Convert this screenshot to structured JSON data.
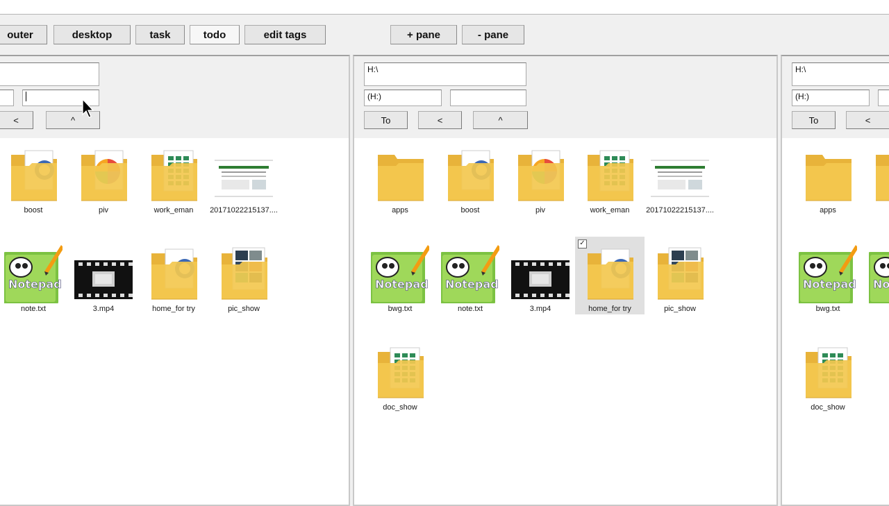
{
  "toolbar": {
    "buttons": [
      {
        "label": "outer"
      },
      {
        "label": "desktop"
      },
      {
        "label": "task"
      },
      {
        "label": "todo"
      },
      {
        "label": "edit tags"
      },
      {
        "label": "+ pane"
      },
      {
        "label": "- pane"
      }
    ]
  },
  "panes": [
    {
      "path": "",
      "drive": "",
      "filter": "",
      "nav": {
        "back": "<",
        "up": "^"
      },
      "items": [
        {
          "label": "boost",
          "icon": "folder-doc-icon"
        },
        {
          "label": "piv",
          "icon": "folder-color-icon"
        },
        {
          "label": "work_eman",
          "icon": "folder-sheet-icon"
        },
        {
          "label": "20171022215137....",
          "icon": "screenshot-icon"
        },
        {
          "label": "note.txt",
          "icon": "notepad-icon"
        },
        {
          "label": "3.mp4",
          "icon": "video-icon"
        },
        {
          "label": "home_for try",
          "icon": "folder-doc-icon"
        },
        {
          "label": "pic_show",
          "icon": "folder-photo-icon"
        }
      ]
    },
    {
      "path": "H:\\",
      "drive": "(H:)",
      "filter": "",
      "nav": {
        "to": "To",
        "back": "<",
        "up": "^"
      },
      "items": [
        {
          "label": "apps",
          "icon": "folder-icon"
        },
        {
          "label": "boost",
          "icon": "folder-doc-icon"
        },
        {
          "label": "piv",
          "icon": "folder-color-icon"
        },
        {
          "label": "work_eman",
          "icon": "folder-sheet-icon"
        },
        {
          "label": "20171022215137....",
          "icon": "screenshot-icon"
        },
        {
          "label": "bwg.txt",
          "icon": "notepad-icon"
        },
        {
          "label": "note.txt",
          "icon": "notepad-icon"
        },
        {
          "label": "3.mp4",
          "icon": "video-icon"
        },
        {
          "label": "home_for try",
          "icon": "folder-doc-icon",
          "selected": true
        },
        {
          "label": "pic_show",
          "icon": "folder-photo-icon"
        },
        {
          "label": "doc_show",
          "icon": "folder-sheet-icon"
        }
      ]
    },
    {
      "path": "H:\\",
      "drive": "(H:)",
      "filter": "",
      "nav": {
        "to": "To",
        "back": "<"
      },
      "items": [
        {
          "label": "apps",
          "icon": "folder-icon"
        },
        {
          "label": "bo",
          "icon": "folder-doc-icon"
        },
        {
          "label": "bwg.txt",
          "icon": "notepad-icon"
        },
        {
          "label": "not",
          "icon": "notepad-icon"
        },
        {
          "label": "doc_show",
          "icon": "folder-sheet-icon"
        }
      ]
    }
  ],
  "colors": {
    "folder": "#f3c84f",
    "folder_back": "#e8b33a",
    "selection": "#e0e0e0",
    "pane_border": "#c8c8c8"
  }
}
